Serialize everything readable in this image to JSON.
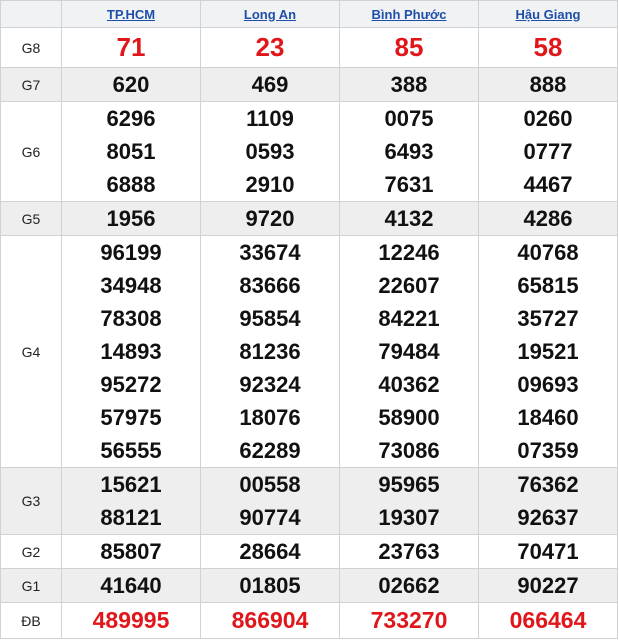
{
  "provinces": [
    "TP.HCM",
    "Long An",
    "Bình Phước",
    "Hậu Giang"
  ],
  "rows": [
    {
      "label": "G8",
      "values": [
        [
          "71"
        ],
        [
          "23"
        ],
        [
          "85"
        ],
        [
          "58"
        ]
      ]
    },
    {
      "label": "G7",
      "values": [
        [
          "620"
        ],
        [
          "469"
        ],
        [
          "388"
        ],
        [
          "888"
        ]
      ]
    },
    {
      "label": "G6",
      "values": [
        [
          "6296",
          "8051",
          "6888"
        ],
        [
          "1109",
          "0593",
          "2910"
        ],
        [
          "0075",
          "6493",
          "7631"
        ],
        [
          "0260",
          "0777",
          "4467"
        ]
      ]
    },
    {
      "label": "G5",
      "values": [
        [
          "1956"
        ],
        [
          "9720"
        ],
        [
          "4132"
        ],
        [
          "4286"
        ]
      ]
    },
    {
      "label": "G4",
      "values": [
        [
          "96199",
          "34948",
          "78308",
          "14893",
          "95272",
          "57975",
          "56555"
        ],
        [
          "33674",
          "83666",
          "95854",
          "81236",
          "92324",
          "18076",
          "62289"
        ],
        [
          "12246",
          "22607",
          "84221",
          "79484",
          "40362",
          "58900",
          "73086"
        ],
        [
          "40768",
          "65815",
          "35727",
          "19521",
          "09693",
          "18460",
          "07359"
        ]
      ]
    },
    {
      "label": "G3",
      "values": [
        [
          "15621",
          "88121"
        ],
        [
          "00558",
          "90774"
        ],
        [
          "95965",
          "19307"
        ],
        [
          "76362",
          "92637"
        ]
      ]
    },
    {
      "label": "G2",
      "values": [
        [
          "85807"
        ],
        [
          "28664"
        ],
        [
          "23763"
        ],
        [
          "70471"
        ]
      ]
    },
    {
      "label": "G1",
      "values": [
        [
          "41640"
        ],
        [
          "01805"
        ],
        [
          "02662"
        ],
        [
          "90227"
        ]
      ]
    },
    {
      "label": "ĐB",
      "values": [
        [
          "489995"
        ],
        [
          "866904"
        ],
        [
          "733270"
        ],
        [
          "066464"
        ]
      ]
    }
  ],
  "colors": {
    "header_link": "#1e4fa8",
    "highlight_red": "#e0161b",
    "shaded_row": "#eeeeee",
    "border": "#cfd3d8"
  }
}
